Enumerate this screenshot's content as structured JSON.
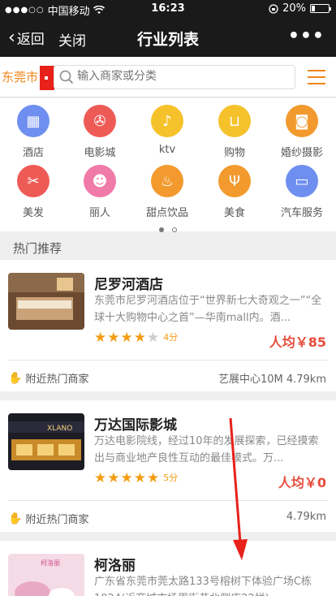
{
  "status_bar": {
    "signal": "●●●○○",
    "carrier": "中国移动",
    "wifi": "wifi",
    "time": "16:23",
    "rotation_lock": "rotation-lock",
    "battery": "20%"
  },
  "nav": {
    "back": "返回",
    "close": "关闭",
    "title": "行业列表",
    "more": "•••"
  },
  "search": {
    "city": "东莞市",
    "placeholder": "输入商家或分类"
  },
  "categories": [
    {
      "label": "酒店",
      "color": "#6f8ff0",
      "icon": "hotel-icon",
      "glyph": "▦"
    },
    {
      "label": "电影城",
      "color": "#ee5a55",
      "icon": "film-icon",
      "glyph": "✇"
    },
    {
      "label": "ktv",
      "color": "#f6c22b",
      "icon": "microphone-icon",
      "glyph": "♪"
    },
    {
      "label": "购物",
      "color": "#f6c22b",
      "icon": "cart-icon",
      "glyph": "⊔"
    },
    {
      "label": "婚纱摄影",
      "color": "#f29a2e",
      "icon": "camera-icon",
      "glyph": "◙"
    },
    {
      "label": "美发",
      "color": "#ee5a55",
      "icon": "scissors-icon",
      "glyph": "✂"
    },
    {
      "label": "丽人",
      "color": "#f07aa8",
      "icon": "beauty-icon",
      "glyph": "☻"
    },
    {
      "label": "甜点饮品",
      "color": "#f29a2e",
      "icon": "dessert-icon",
      "glyph": "♨"
    },
    {
      "label": "美食",
      "color": "#f29a2e",
      "icon": "food-icon",
      "glyph": "Ψ"
    },
    {
      "label": "汽车服务",
      "color": "#6f8ff0",
      "icon": "car-icon",
      "glyph": "▭"
    }
  ],
  "section_title": "热门推荐",
  "merchants": [
    {
      "name": "尼罗河酒店",
      "desc": "东莞市尼罗河酒店位于“世界新七大奇观之一”“全球十大购物中心之首”—华南mall内。酒...",
      "rating": 4,
      "score": "4分",
      "price": "人均￥85",
      "hot": "附近热门商家",
      "location": "艺展中心10M 4.79km",
      "thumb_colors": [
        "#6b4a30",
        "#c9a27a",
        "#f2e6d0"
      ]
    },
    {
      "name": "万达国际影城",
      "desc": "万达电影院线，经过10年的发展探索，已经摸索出与商业地产良性互动的最佳模式。万...",
      "rating": 5,
      "score": "5分",
      "price": "人均￥0",
      "hot": "附近热门商家",
      "location": "4.79km",
      "thumb_colors": [
        "#1c1c24",
        "#c98a2a",
        "#f5d27a"
      ],
      "thumb_sign": "XLANO"
    },
    {
      "name": "柯洛丽",
      "desc": "广东省东莞市莞太路133号榕树下体验广场C栋1024(近商城市场周街巷北侧店22栏)",
      "thumb_colors": [
        "#f4dbe6",
        "#e9a9c4",
        "#ffffff"
      ],
      "thumb_sign": "柯洛丽"
    }
  ]
}
